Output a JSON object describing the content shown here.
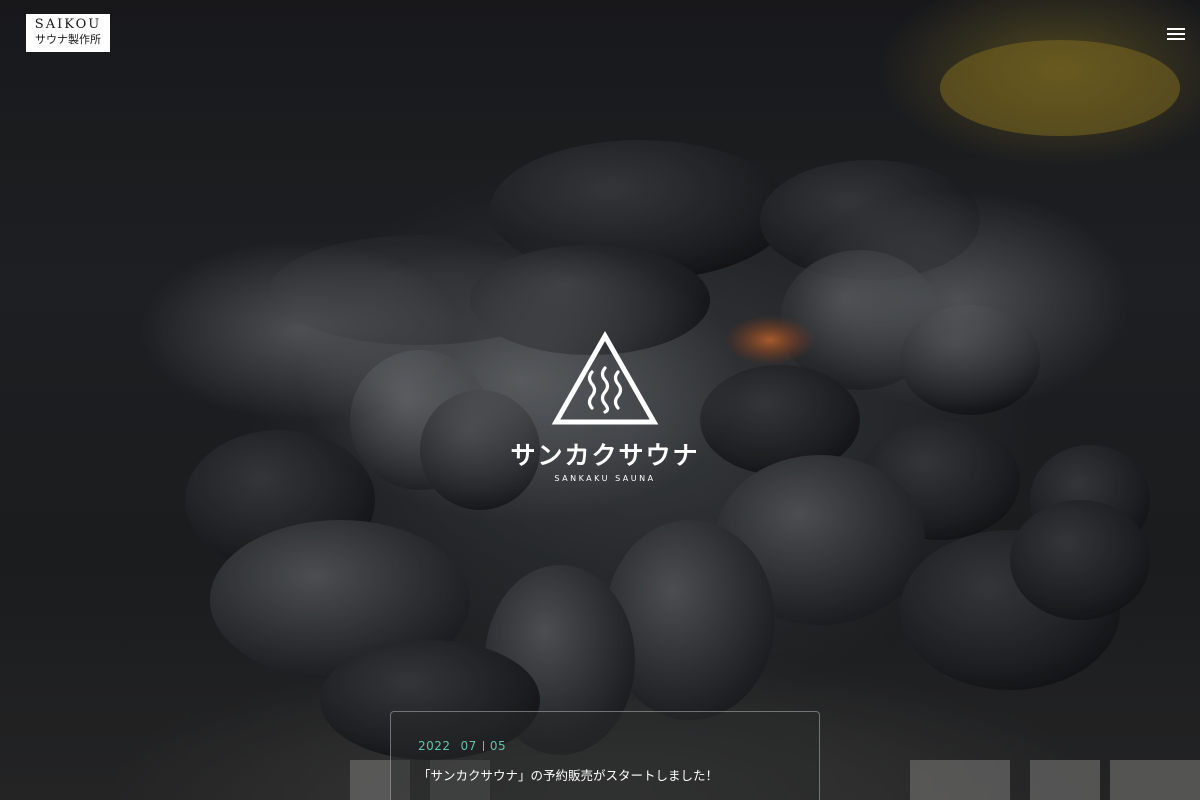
{
  "header": {
    "brand_en": "SAIKOU",
    "brand_ja": "サウナ製作所",
    "menu_icon": "hamburger-menu-icon"
  },
  "hero": {
    "product_name": "サンカクサウナ",
    "product_sub": "SANKAKU SAUNA",
    "logo_icon": "triangle-steam-icon"
  },
  "news": {
    "year": "2022",
    "month": "07",
    "day": "05",
    "title": "「サンカクサウナ」の予約販売がスタートしました！"
  },
  "colors": {
    "accent": "#5fc7a8",
    "text": "#ffffff",
    "background": "#151617"
  }
}
